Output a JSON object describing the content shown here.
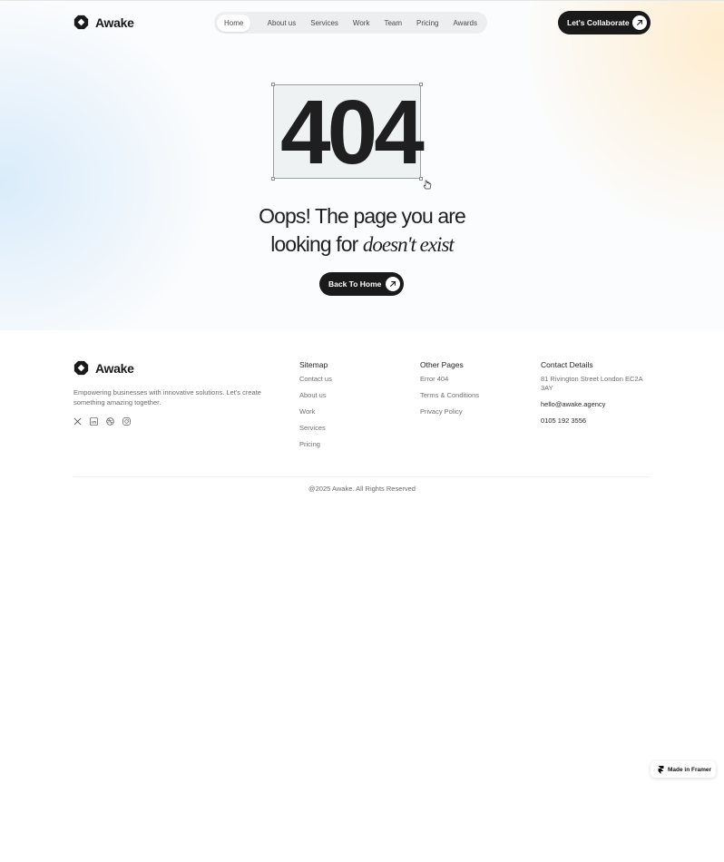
{
  "brand": {
    "name": "Awake"
  },
  "nav": {
    "items": [
      {
        "label": "Home",
        "active": true
      },
      {
        "label": "About us"
      },
      {
        "label": "Services"
      },
      {
        "label": "Work"
      },
      {
        "label": "Team"
      },
      {
        "label": "Pricing"
      },
      {
        "label": "Awards"
      }
    ],
    "cta_label": "Let's Collaborate"
  },
  "error": {
    "code": "404",
    "headline_part1": "Oops! The page you are",
    "headline_part2": "looking for ",
    "headline_italic": "doesn't exist",
    "button_label": "Back To Home"
  },
  "footer": {
    "description": "Empowering businesses with innovative solutions. Let's create something amazing together.",
    "socials": [
      "x-icon",
      "linkedin-icon",
      "dribbble-icon",
      "instagram-icon"
    ],
    "sitemap": {
      "title": "Sitemap",
      "links": [
        "Contact us",
        "About us",
        "Work",
        "Services",
        "Pricing"
      ]
    },
    "other_pages": {
      "title": "Other Pages",
      "links": [
        "Error 404",
        "Terms & Conditions",
        "Privacy Policy"
      ]
    },
    "contact": {
      "title": "Contact Details",
      "address": "81 Rivington Street London EC2A 3AY",
      "email": "hello@awake.agency",
      "phone": "0105 192 3556"
    },
    "copyright": "@2025 Awake. All Rights Reserved"
  },
  "badge": {
    "label": "Made in Framer"
  },
  "colors": {
    "dark": "#1a1a1a",
    "accent_warm": "#ffecc8",
    "accent_cool": "#d6eafa"
  }
}
